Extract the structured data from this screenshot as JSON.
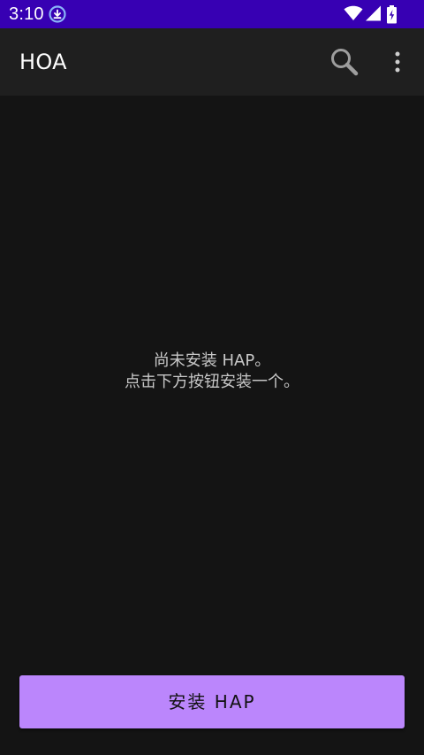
{
  "status_bar": {
    "time": "3:10",
    "background": "#3700b3",
    "icons": [
      "download-icon",
      "wifi-icon",
      "signal-icon",
      "battery-charging-icon"
    ]
  },
  "app_bar": {
    "title": "HOA",
    "actions": [
      "search-icon",
      "more-vert-icon"
    ]
  },
  "empty_state": {
    "line1": "尚未安装 HAP。",
    "line2": "点击下方按钮安装一个。"
  },
  "install_button": {
    "label": "安装 HAP",
    "color": "#bb86fc"
  },
  "theme": {
    "background": "#141414",
    "app_bar": "#1f1f1f",
    "accent": "#bb86fc"
  }
}
